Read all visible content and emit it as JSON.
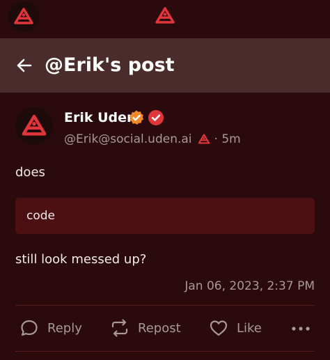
{
  "header": {
    "title": "@Erik's post"
  },
  "post": {
    "author_name": "Erik Uden",
    "handle": "@Erik@social.uden.ai",
    "time_ago": "· 5m",
    "text_before": "does",
    "code": "code",
    "text_after": "still look messed up?",
    "timestamp": "Jan 06, 2023, 2:37 PM"
  },
  "actions": {
    "reply_label": "Reply",
    "repost_label": "Repost",
    "like_label": "Like"
  },
  "colors": {
    "background": "#2a0a0c",
    "header": "#4a2c2d",
    "code_block": "#4d1012",
    "brand_red": "#e0353b",
    "badge_orange": "#f08a2a",
    "muted_text": "#a8989a"
  }
}
